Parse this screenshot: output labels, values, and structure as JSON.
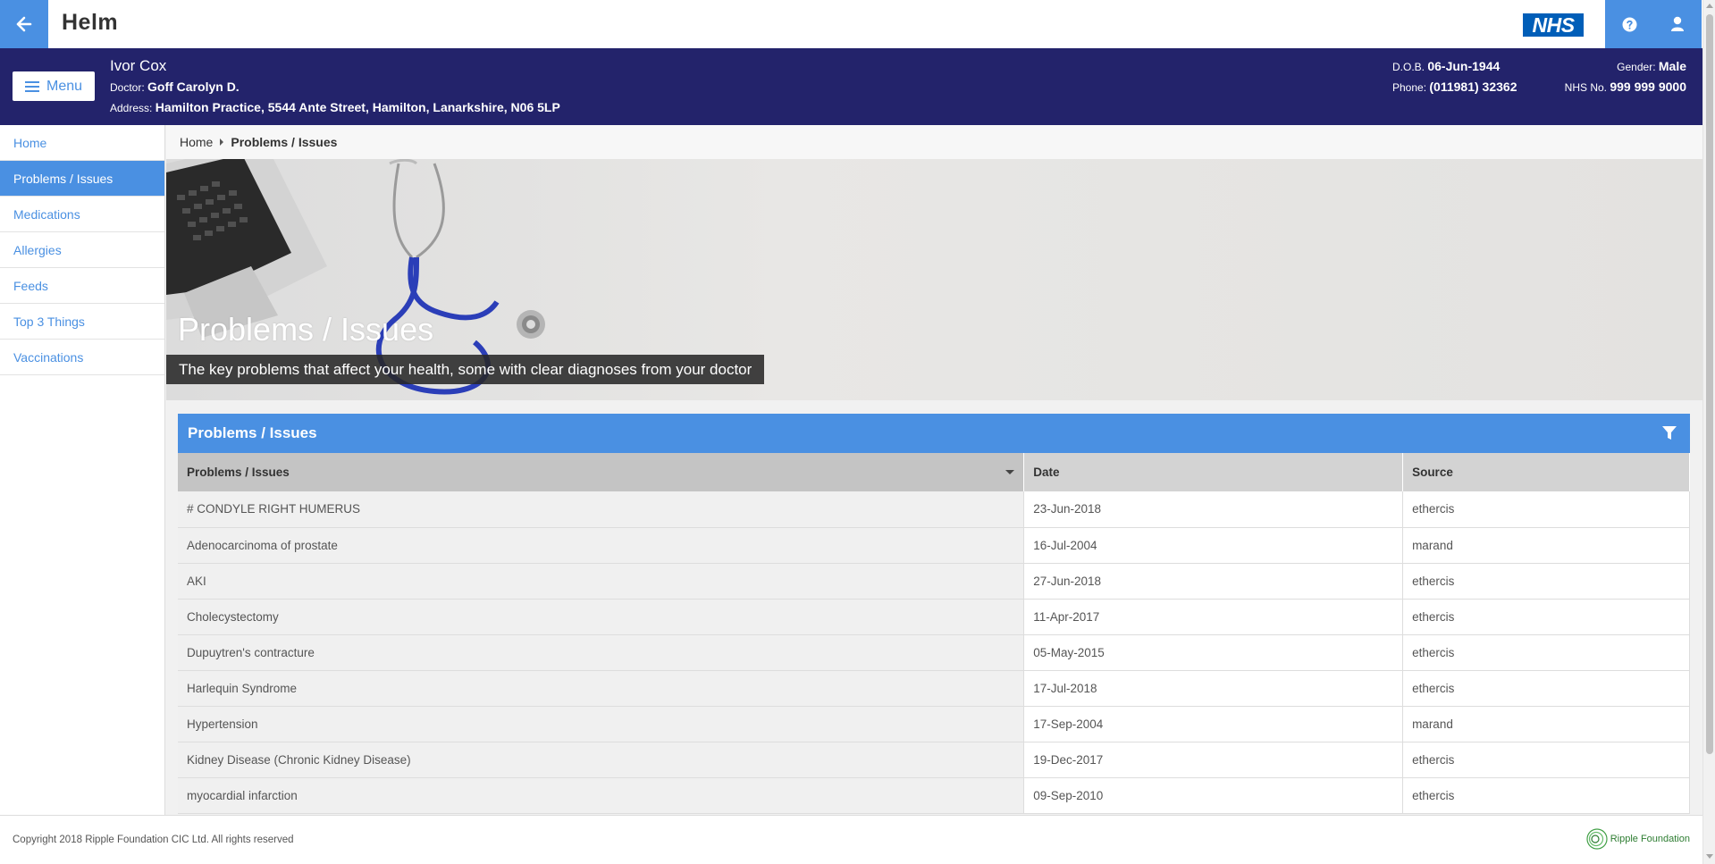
{
  "app": {
    "logo": "Helm",
    "nhs_logo": "NHS"
  },
  "topbar": {
    "back_icon": "arrow-left-icon",
    "help_icon": "question-circle-icon",
    "user_icon": "user-icon"
  },
  "patient": {
    "name": "Ivor Cox",
    "doctor_label": "Doctor:",
    "doctor": "Goff Carolyn D.",
    "address_label": "Address:",
    "address": "Hamilton Practice, 5544 Ante Street, Hamilton, Lanarkshire, N06 5LP",
    "dob_label": "D.O.B.",
    "dob": "06-Jun-1944",
    "phone_label": "Phone:",
    "phone": "(011981) 32362",
    "gender_label": "Gender:",
    "gender": "Male",
    "nhs_label": "NHS No.",
    "nhs_no": "999 999 9000"
  },
  "menu": {
    "label": "Menu"
  },
  "sidebar": {
    "items": [
      {
        "label": "Home",
        "active": false
      },
      {
        "label": "Problems / Issues",
        "active": true
      },
      {
        "label": "Medications",
        "active": false
      },
      {
        "label": "Allergies",
        "active": false
      },
      {
        "label": "Feeds",
        "active": false
      },
      {
        "label": "Top 3 Things",
        "active": false
      },
      {
        "label": "Vaccinations",
        "active": false
      }
    ]
  },
  "breadcrumb": {
    "home": "Home",
    "current": "Problems / Issues"
  },
  "hero": {
    "title": "Problems / Issues",
    "subtitle": "The key problems that affect your health, some with clear diagnoses from your doctor"
  },
  "panel": {
    "title": "Problems / Issues",
    "filter_icon": "filter-icon"
  },
  "table": {
    "headers": [
      "Problems / Issues",
      "Date",
      "Source"
    ],
    "rows": [
      [
        "# CONDYLE RIGHT HUMERUS",
        "23-Jun-2018",
        "ethercis"
      ],
      [
        "Adenocarcinoma of prostate",
        "16-Jul-2004",
        "marand"
      ],
      [
        "AKI",
        "27-Jun-2018",
        "ethercis"
      ],
      [
        "Cholecystectomy",
        "11-Apr-2017",
        "ethercis"
      ],
      [
        "Dupuytren's contracture",
        "05-May-2015",
        "ethercis"
      ],
      [
        "Harlequin Syndrome",
        "17-Jul-2018",
        "ethercis"
      ],
      [
        "Hypertension",
        "17-Sep-2004",
        "marand"
      ],
      [
        "Kidney Disease (Chronic Kidney Disease)",
        "19-Dec-2017",
        "ethercis"
      ],
      [
        "myocardial infarction",
        "09-Sep-2010",
        "ethercis"
      ]
    ]
  },
  "footer": {
    "copyright": "Copyright 2018 Ripple Foundation CIC Ltd. All rights reserved",
    "ripple_logo": "Ripple Foundation"
  },
  "colors": {
    "accent": "#4a90e2",
    "banner": "#23236b",
    "nhs": "#005eb8"
  }
}
